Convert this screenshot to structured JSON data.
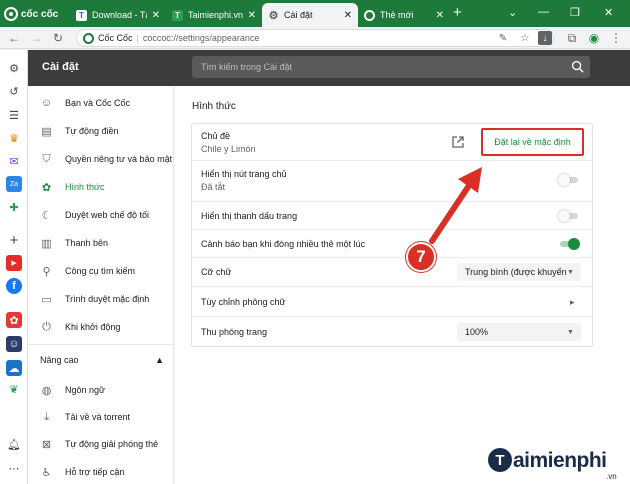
{
  "browser": {
    "brand": "cốc cốc",
    "tabs": [
      {
        "label": "Download - Tải",
        "favicon": "T",
        "active": false
      },
      {
        "label": "Taimienphi.vn",
        "favicon": "T",
        "active": false
      },
      {
        "label": "Cài đặt",
        "favicon": "gear",
        "active": true
      },
      {
        "label": "Thẻ mới",
        "favicon": "coccoc",
        "active": false
      }
    ],
    "url_site": "Cốc Cốc",
    "url_path": "coccoc://settings/appearance"
  },
  "settings": {
    "title": "Cài đặt",
    "search_placeholder": "Tìm kiếm trong Cài đặt"
  },
  "nav": {
    "items": [
      {
        "label": "Bạn và Cốc Cốc",
        "icon": "person-icon"
      },
      {
        "label": "Tự động điền",
        "icon": "clipboard-icon"
      },
      {
        "label": "Quyền riêng tư và bảo mật",
        "icon": "shield-icon"
      },
      {
        "label": "Hình thức",
        "icon": "palette-icon",
        "active": true
      },
      {
        "label": "Duyệt web chế độ tối",
        "icon": "moon-icon"
      },
      {
        "label": "Thanh bên",
        "icon": "sidebar-icon"
      },
      {
        "label": "Công cụ tìm kiếm",
        "icon": "search-icon"
      },
      {
        "label": "Trình duyệt mặc định",
        "icon": "browser-icon"
      },
      {
        "label": "Khi khởi động",
        "icon": "power-icon"
      }
    ],
    "advanced_label": "Nâng cao",
    "advanced_items": [
      {
        "label": "Ngôn ngữ",
        "icon": "globe-icon"
      },
      {
        "label": "Tải về và torrent",
        "icon": "download-icon"
      },
      {
        "label": "Tự động giải phóng thẻ",
        "icon": "tab-free-icon"
      },
      {
        "label": "Hỗ trợ tiếp cận",
        "icon": "accessibility-icon"
      }
    ]
  },
  "appearance": {
    "section_title": "Hình thức",
    "theme_label": "Chủ đề",
    "theme_value": "Chile y Limón",
    "reset_label": "Đặt lại về mặc định",
    "home_button_label": "Hiển thị nút trang chủ",
    "home_button_value": "Đã tắt",
    "home_button_on": false,
    "bookmarks_bar_label": "Hiển thị thanh dấu trang",
    "bookmarks_bar_on": false,
    "warn_close_label": "Cảnh báo bạn khi đóng nhiều thẻ một lúc",
    "warn_close_on": true,
    "font_size_label": "Cỡ chữ",
    "font_size_value": "Trung bình (được khuyến nghị)",
    "customize_fonts_label": "Tùy chỉnh phông chữ",
    "zoom_label": "Thu phóng trang",
    "zoom_value": "100%"
  },
  "annotation": {
    "step": "7"
  },
  "watermark": {
    "letter": "T",
    "name": "aimienphi",
    "tld": ".vn"
  },
  "colors": {
    "brand_green": "#1e7a3a",
    "accent_green": "#1a8a3c",
    "highlight_red": "#d93025"
  }
}
